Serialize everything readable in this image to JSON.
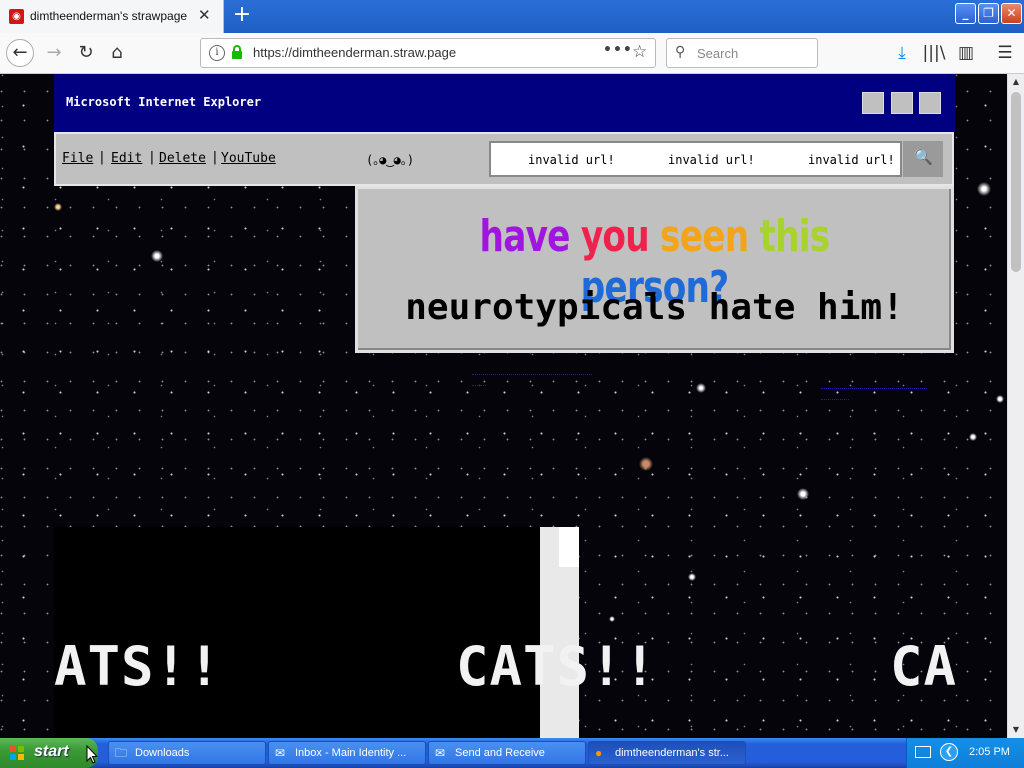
{
  "browser": {
    "tab_title": "dimtheenderman's strawpage",
    "tab_close": "✕",
    "new_tab": "+",
    "window_buttons": {
      "minimize": "_",
      "maximize": "❐",
      "close": "✕"
    }
  },
  "navbar": {
    "back": "←",
    "forward": "→",
    "reload": "↻",
    "home": "⌂",
    "url": "https://dimtheenderman.straw.page",
    "page_actions": "•••",
    "bookmark": "☆",
    "search_placeholder": "Search",
    "download": "⤓",
    "library": "|||\\",
    "sidebar": "▥",
    "menu": "☰"
  },
  "page": {
    "ie_title": "Microsoft Internet Explorer",
    "menu_items": [
      "File",
      "Edit",
      "Delete",
      "YouTube"
    ],
    "separator": "|",
    "kaomoji": "(｡◕‿◕｡)",
    "url_entries": [
      "invalid url!",
      "invalid url!",
      "invalid url!"
    ],
    "search_icon": "🔍",
    "poster": {
      "headline_words": [
        "have",
        "you",
        "seen",
        "this",
        "person?"
      ],
      "subline": "neurotypicals hate him!"
    },
    "cats": [
      "ATS!!",
      "CATS!!",
      "CA"
    ]
  },
  "taskbar": {
    "start_label": "start",
    "buttons": [
      {
        "label": "Downloads",
        "icon": "folder-icon",
        "glyph": "🗀"
      },
      {
        "label": "Inbox - Main Identity ...",
        "icon": "outlook-express-icon",
        "glyph": "✉"
      },
      {
        "label": "Send and Receive",
        "icon": "send-receive-icon",
        "glyph": "✉"
      },
      {
        "label": "dimtheenderman's str...",
        "icon": "firefox-icon",
        "glyph": "●"
      }
    ],
    "clock": "2:05 PM"
  },
  "colors": {
    "ie_titlebar": "#000080",
    "win95_gray": "#c0c0c0",
    "xp_taskbar": "#245edb",
    "xp_start": "#3c9a36"
  }
}
